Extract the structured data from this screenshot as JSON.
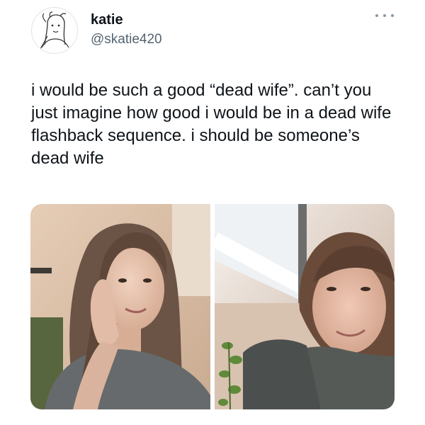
{
  "author": {
    "display_name": "katie",
    "handle": "@skatie420",
    "avatar_icon": "line-drawing-avatar-icon"
  },
  "header": {
    "more_icon": "more-horizontal-icon"
  },
  "tweet": {
    "text": "i would be such a good “dead wife”. can’t you just imagine how good i would be in a dead wife flashback sequence. i should be someone’s dead wife"
  },
  "media": {
    "count": 2,
    "photos": [
      {
        "icon": "selfie-photo",
        "background_color": "#d9c1ad"
      },
      {
        "icon": "selfie-photo",
        "background_color": "#c9b7a6"
      }
    ]
  },
  "colors": {
    "text": "#0f1419",
    "secondary_text": "#536471",
    "more_dots": "#8b98a5"
  }
}
